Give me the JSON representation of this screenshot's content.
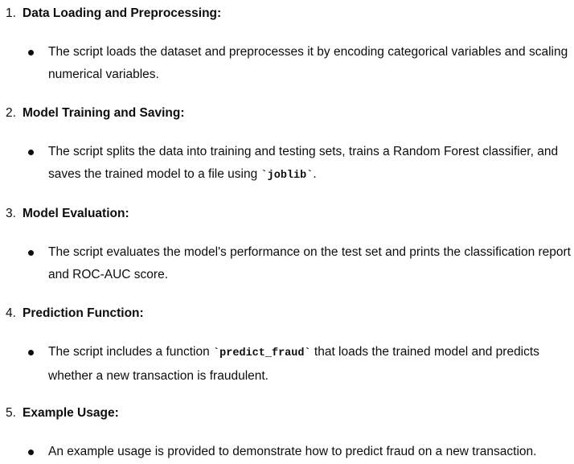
{
  "items": [
    {
      "number": "1.",
      "heading": "Data Loading and Preprocessing:",
      "text": "The script loads the dataset and preprocesses it by encoding categorical variables and scaling numerical variables."
    },
    {
      "number": "2.",
      "heading": "Model Training and Saving:",
      "text_before": "The script splits the data into training and testing sets, trains a Random Forest classifier, and saves the trained model to a file using ",
      "code": "`joblib`",
      "text_after": "."
    },
    {
      "number": "3.",
      "heading": "Model Evaluation:",
      "text": "The script evaluates the model's performance on the test set and prints the classification report and ROC-AUC score."
    },
    {
      "number": "4.",
      "heading": "Prediction Function:",
      "text_before": "The script includes a function ",
      "code": "`predict_fraud`",
      "text_after": " that loads the trained model and predicts whether a new transaction is fraudulent."
    },
    {
      "number": "5.",
      "heading": "Example Usage:",
      "text": "An example usage is provided to demonstrate how to predict fraud on a new transaction."
    }
  ]
}
